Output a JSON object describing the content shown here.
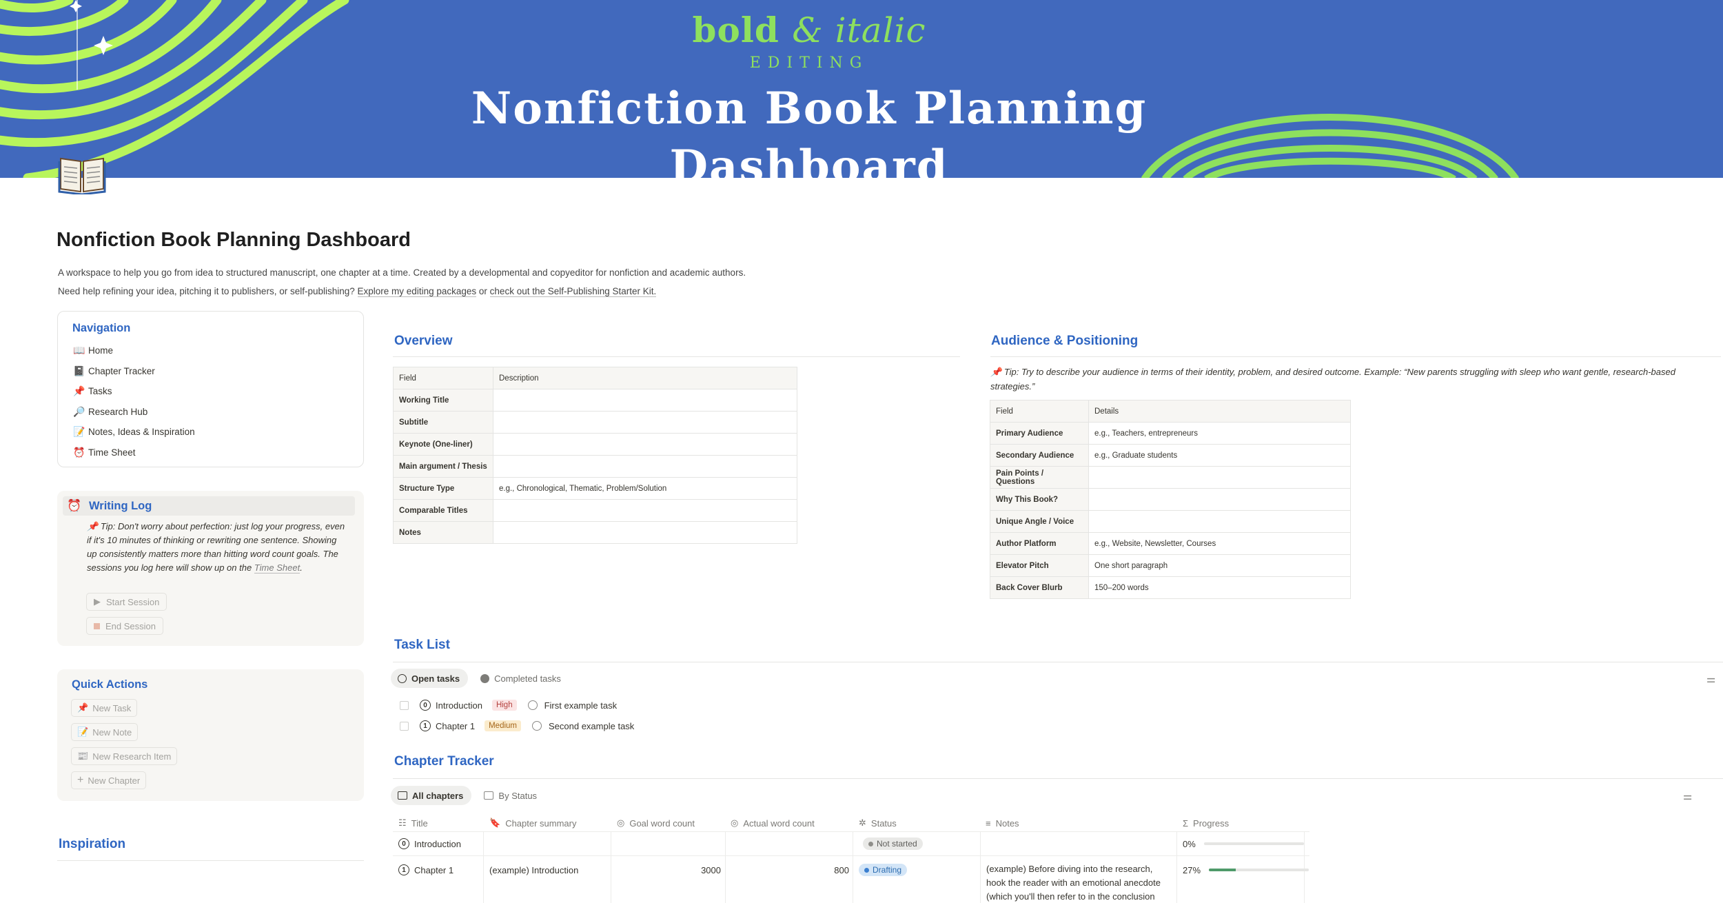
{
  "banner": {
    "brand_bold": "bold",
    "brand_amp_italic": "& italic",
    "brand_sub": "EDITING",
    "title_line1": "Nonfiction Book Planning",
    "title_line2": "Dashboard",
    "colors": {
      "background": "#4169bd",
      "accent": "#b8f55c"
    }
  },
  "page": {
    "icon": "open-book-icon",
    "title": "Nonfiction Book Planning Dashboard",
    "description_line1": "A workspace to help you go from idea to structured manuscript, one chapter at a time. Created by a developmental and copyeditor for nonfiction and academic authors.",
    "description_line2_a": "Need help refining your idea, pitching it to publishers, or self-publishing?",
    "description_link1": "Explore my editing packages",
    "description_or": "or",
    "description_link2": "check out the Self-Publishing Starter Kit."
  },
  "navigation": {
    "title": "Navigation",
    "items": [
      {
        "icon": "📖",
        "label": "Home"
      },
      {
        "icon": "📓",
        "label": "Chapter Tracker"
      },
      {
        "icon": "📌",
        "label": "Tasks"
      },
      {
        "icon": "🔎",
        "label": "Research Hub"
      },
      {
        "icon": "📝",
        "label": "Notes, Ideas & Inspiration"
      },
      {
        "icon": "⏰",
        "label": "Time Sheet"
      }
    ]
  },
  "writing_log": {
    "icon": "⏰",
    "title": "Writing Log",
    "tip_pin": "📌",
    "tip_text": "Tip: Don't worry about perfection: just log your progress, even if it's 10 minutes of thinking or rewriting one sentence. Showing up consistently matters more than hitting word count goals. The sessions you log here will show up on the",
    "tip_link": "Time Sheet",
    "tip_end": ".",
    "start_button": "Start Session",
    "end_button": "End Session"
  },
  "quick_actions": {
    "title": "Quick Actions",
    "buttons": [
      {
        "icon": "📌",
        "label": "New Task"
      },
      {
        "icon": "📝",
        "label": "New Note"
      },
      {
        "icon": "📰",
        "label": "New Research Item"
      },
      {
        "icon": "+",
        "label": "New Chapter"
      }
    ]
  },
  "inspiration": {
    "title": "Inspiration"
  },
  "overview": {
    "title": "Overview",
    "header": {
      "field": "Field",
      "desc": "Description"
    },
    "rows": [
      {
        "field": "Working Title",
        "value": ""
      },
      {
        "field": "Subtitle",
        "value": ""
      },
      {
        "field": "Keynote (One-liner)",
        "value": ""
      },
      {
        "field": "Main argument / Thesis",
        "value": ""
      },
      {
        "field": "Structure Type",
        "value": "e.g., Chronological, Thematic, Problem/Solution"
      },
      {
        "field": "Comparable Titles",
        "value": ""
      },
      {
        "field": "Notes",
        "value": ""
      }
    ]
  },
  "audience": {
    "title": "Audience & Positioning",
    "tip_pin": "📌",
    "tip": "Tip: Try to describe your audience in terms of their identity, problem, and desired outcome. Example: “New parents struggling with sleep who want gentle, research-based strategies.”",
    "header": {
      "field": "Field",
      "details": "Details"
    },
    "rows": [
      {
        "field": "Primary Audience",
        "value": "e.g., Teachers, entrepreneurs"
      },
      {
        "field": "Secondary Audience",
        "value": "e.g., Graduate students"
      },
      {
        "field": "Pain Points / Questions",
        "value": ""
      },
      {
        "field": "Why This Book?",
        "value": ""
      },
      {
        "field": "Unique Angle / Voice",
        "value": ""
      },
      {
        "field": "Author Platform",
        "value": "e.g., Website, Newsletter, Courses"
      },
      {
        "field": "Elevator Pitch",
        "value": "One short paragraph"
      },
      {
        "field": "Back Cover Blurb",
        "value": "150–200 words"
      }
    ]
  },
  "task_list": {
    "title": "Task List",
    "tabs": {
      "open": "Open tasks",
      "completed": "Completed tasks"
    },
    "rows": [
      {
        "num": "0",
        "chapter": "Introduction",
        "priority": "High",
        "task": "First example task"
      },
      {
        "num": "1",
        "chapter": "Chapter 1",
        "priority": "Medium",
        "task": "Second example task"
      }
    ]
  },
  "chapter_tracker": {
    "title": "Chapter Tracker",
    "tabs": {
      "all": "All chapters",
      "status": "By Status"
    },
    "columns": {
      "title": "Title",
      "summary": "Chapter summary",
      "goal": "Goal word count",
      "actual": "Actual word count",
      "status": "Status",
      "notes": "Notes",
      "progress": "Progress"
    },
    "rows": [
      {
        "num": "0",
        "title": "Introduction",
        "summary": "",
        "goal": "",
        "actual": "",
        "status": "Not started",
        "notes": "",
        "progress_label": "0%",
        "progress": 0
      },
      {
        "num": "1",
        "title": "Chapter 1",
        "summary": "(example) Introduction",
        "goal": "3000",
        "actual": "800",
        "status": "Drafting",
        "notes_line1": "(example) Before diving into the research,",
        "notes_line2": "hook the reader with an emotional anecdote",
        "notes_line3": "(which you'll then refer to in the conclusion",
        "progress_label": "27%",
        "progress": 0.27
      }
    ]
  }
}
